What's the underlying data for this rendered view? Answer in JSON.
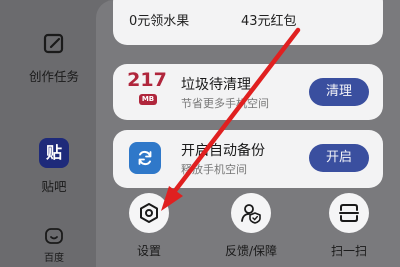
{
  "sidebar": {
    "items": [
      {
        "label": "创作任务",
        "icon": "edit-square-icon"
      },
      {
        "label": "贴吧",
        "tile_text": "贴",
        "icon": "tieba-app-icon"
      },
      {
        "label": "百度",
        "icon": "baidu-home-icon"
      }
    ]
  },
  "top_card": {
    "left_label": "0元领水果",
    "right_label": "43元红包"
  },
  "clean_card": {
    "number": "217",
    "unit": "MB",
    "title": "垃圾待清理",
    "subtitle": "节省更多手机空间",
    "button": "清理"
  },
  "backup_card": {
    "title": "开启自动备份",
    "subtitle": "释放手机空间",
    "button": "开启"
  },
  "tools": [
    {
      "label": "设置",
      "icon": "settings-hexagon-icon"
    },
    {
      "label": "反馈/保障",
      "icon": "feedback-shield-icon"
    },
    {
      "label": "扫一扫",
      "icon": "scan-icon"
    }
  ],
  "colors": {
    "accent_button": "#3a4f9f",
    "storage_red": "#b0263c",
    "arrow_red": "#e02020"
  }
}
